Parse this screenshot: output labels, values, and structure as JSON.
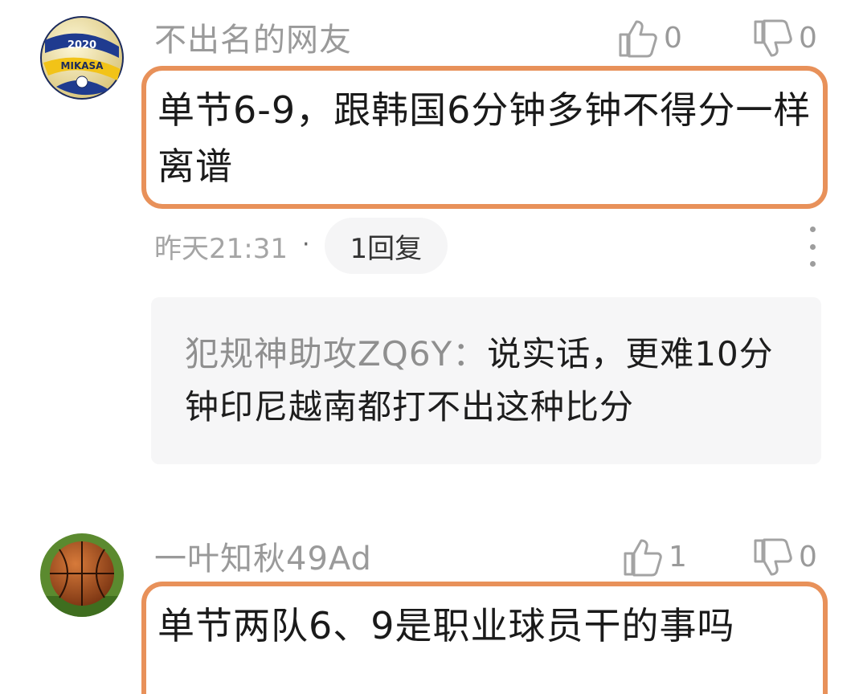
{
  "comments": [
    {
      "username": "不出名的网友",
      "avatar": "volleyball-avatar",
      "avatar_text_top": "2020",
      "avatar_text_brand": "MIKASA",
      "likes": "0",
      "dislikes": "0",
      "content": "单节6-9，跟韩国6分钟多钟不得分一样离谱",
      "time": "昨天21:31",
      "separator": "·",
      "reply_count_label": "1回复",
      "reply": {
        "author": "犯规神助攻ZQ6Y：",
        "text": "说实话，更难10分钟印尼越南都打不出这种比分"
      }
    },
    {
      "username": "一叶知秋49Ad",
      "avatar": "basketball-avatar",
      "likes": "1",
      "dislikes": "0",
      "content": "单节两队6、9是职业球员干的事吗"
    }
  ],
  "colors": {
    "highlight_border": "#e8915a",
    "muted_text": "#9a9a9a",
    "reply_bg": "#f6f6f7"
  },
  "icons": [
    "thumbs-up-icon",
    "thumbs-down-icon",
    "more-vertical-icon"
  ]
}
